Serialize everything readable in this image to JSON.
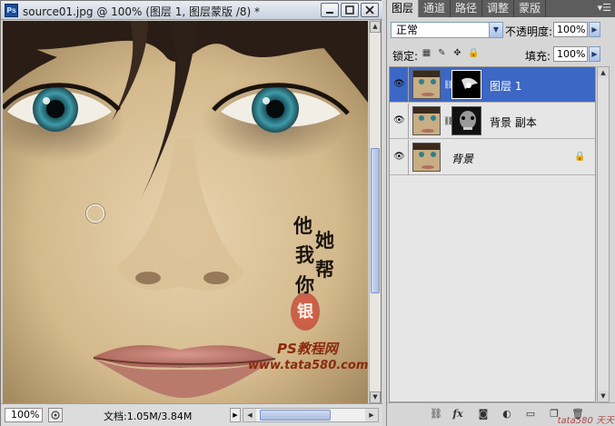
{
  "document": {
    "app_icon": "Ps",
    "title": "source01.jpg @ 100% (图层 1, 图层蒙版 /8) *",
    "zoom": "100%",
    "doc_info": "文档:1.05M/3.84M",
    "watermark": {
      "calligraphy": [
        "他",
        "她",
        "我",
        "帮",
        "你"
      ],
      "seal": "银",
      "site_name": "PS教程网",
      "site_url": "www.tata580.com"
    }
  },
  "panel": {
    "tabs": [
      "图层",
      "通道",
      "路径",
      "调整",
      "蒙版"
    ],
    "active_tab": 0,
    "menu_icon": "panel-menu-icon",
    "blend_mode": "正常",
    "opacity_label": "不透明度:",
    "opacity_value": "100%",
    "lock_label": "锁定:",
    "fill_label": "填充:",
    "fill_value": "100%",
    "layers": [
      {
        "name": "图层 1",
        "selected": true,
        "has_mask": true,
        "locked": false
      },
      {
        "name": "背景 副本",
        "selected": false,
        "has_mask": true,
        "locked": false
      },
      {
        "name": "背景",
        "selected": false,
        "has_mask": false,
        "locked": true
      }
    ],
    "footer_watermark": "tata580 天天"
  },
  "colors": {
    "selected_layer": "#3d67c4",
    "panel_tab_bar": "#5d5d5d",
    "title_bar": "#c9d1de"
  }
}
